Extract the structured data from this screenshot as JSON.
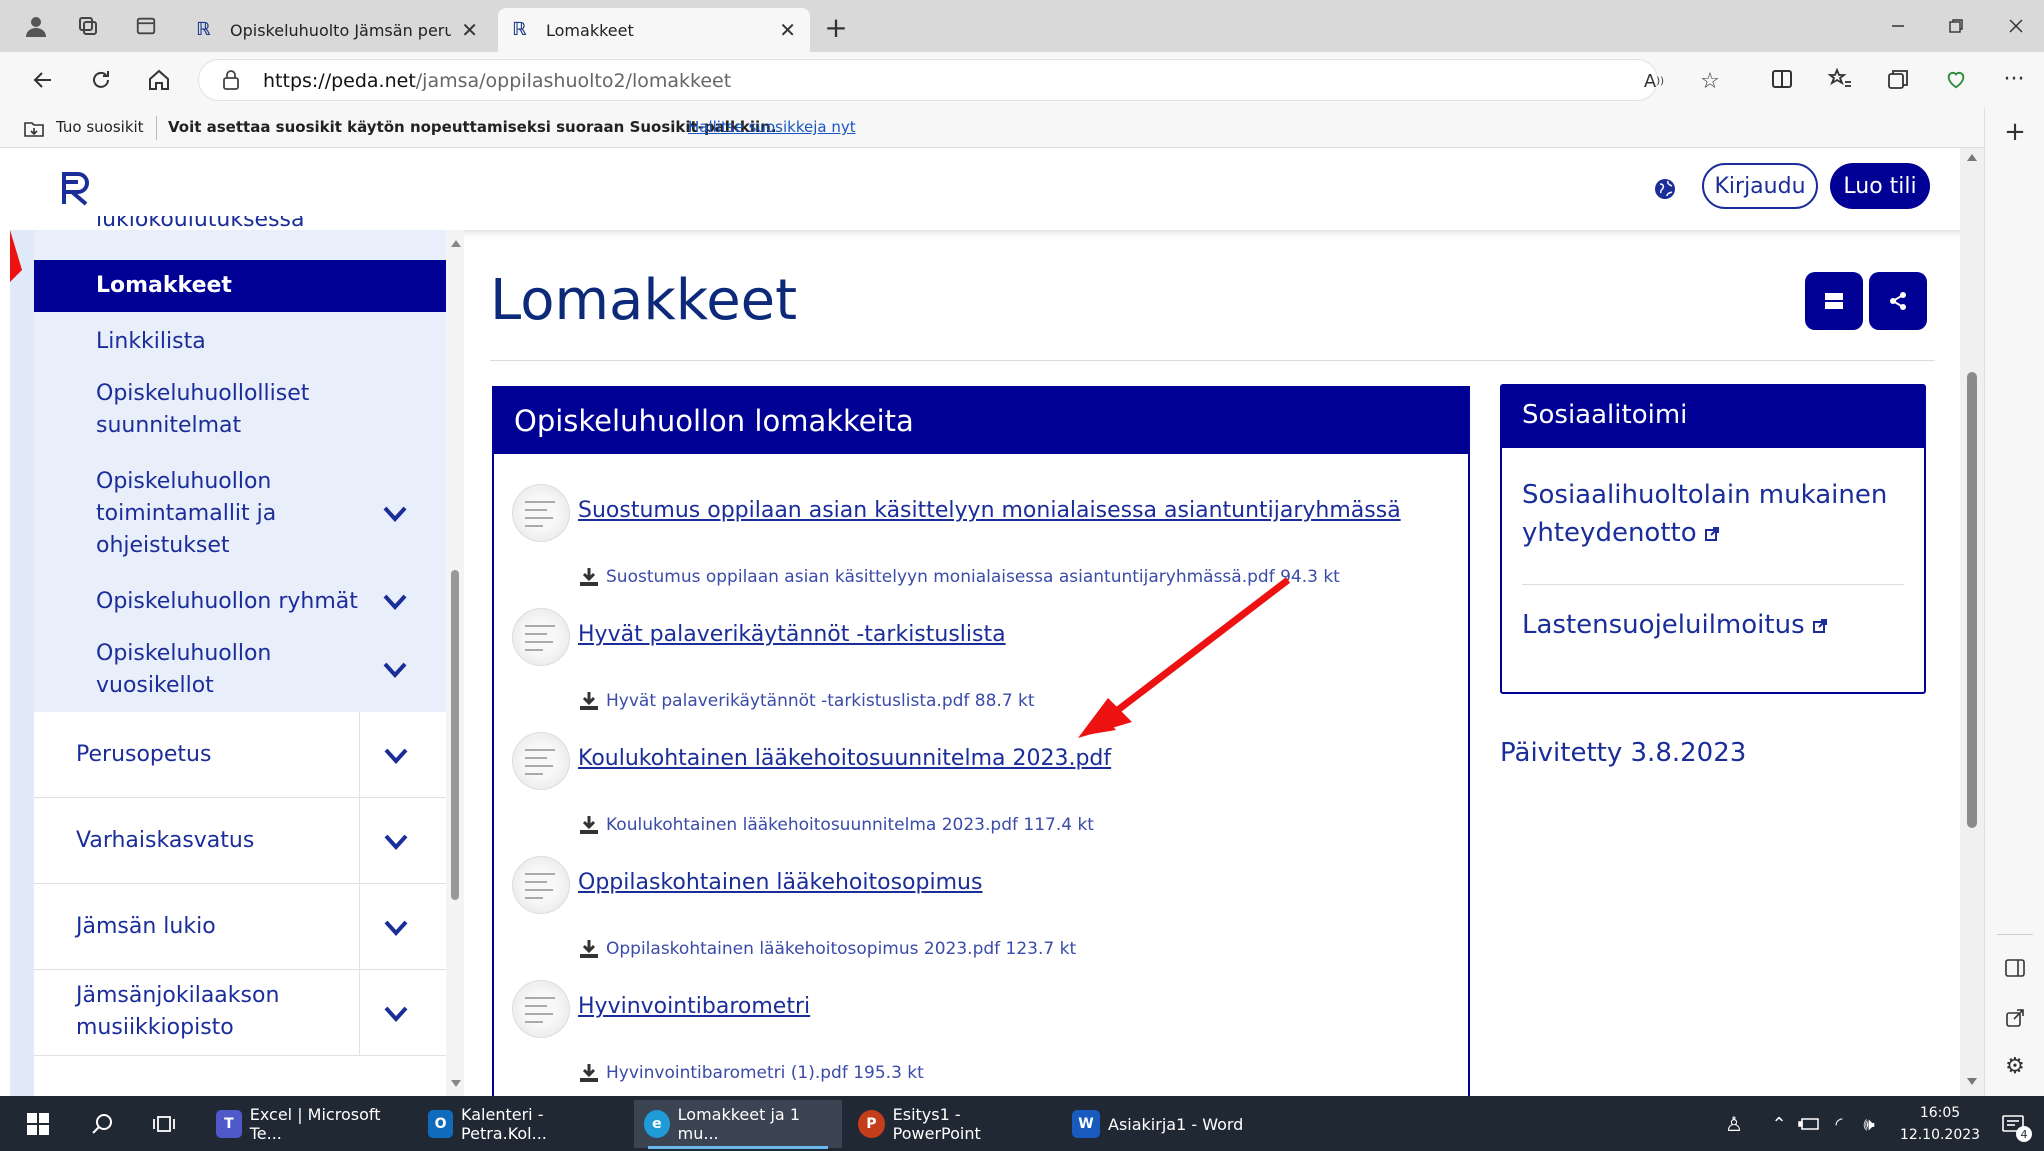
{
  "browser": {
    "tabs": [
      {
        "label": "Opiskeluhuolto Jämsän perusope",
        "active": false
      },
      {
        "label": "Lomakkeet",
        "active": true
      }
    ],
    "url_host": "https://peda.net",
    "url_path": "/jamsa/oppilashuolto2/lomakkeet",
    "favorites_import": "Tuo suosikit",
    "favorites_message": "Voit asettaa suosikit käytön nopeuttamiseksi suoraan Suosikit-palkkiin.",
    "favorites_link": "Hallitse suosikkeja nyt"
  },
  "header": {
    "login": "Kirjaudu",
    "create_account": "Luo tili"
  },
  "sidebar": {
    "partial_item": "lukiokoulutuksessa",
    "sub_items": [
      {
        "label": "Lomakkeet",
        "active": true
      },
      {
        "label": "Linkkilista"
      },
      {
        "label": "Opiskeluhuollolliset suunnitelmat"
      },
      {
        "label": "Opiskeluhuollon toimintamallit ja ohjeistukset"
      },
      {
        "label": "Opiskeluhuollon ryhmät"
      },
      {
        "label": "Opiskeluhuollon vuosikellot"
      }
    ],
    "main_items": [
      {
        "label": "Perusopetus"
      },
      {
        "label": "Varhaiskasvatus"
      },
      {
        "label": "Jämsän lukio"
      },
      {
        "label": "Jämsänjokilaakson musiikkiopisto"
      }
    ]
  },
  "main": {
    "title": "Lomakkeet",
    "card_title": "Opiskeluhuollon lomakkeita",
    "files": [
      {
        "title": "Suostumus oppilaan asian käsittelyyn monialaisessa asiantuntijaryhmässä",
        "download": "Suostumus oppilaan asian käsittelyyn monialaisessa asiantuntijaryhmässä.pdf 94.3 kt"
      },
      {
        "title": "Hyvät palaverikäytännöt -tarkistuslista",
        "download": "Hyvät palaverikäytännöt -tarkistuslista.pdf 88.7 kt"
      },
      {
        "title": "Koulukohtainen lääkehoitosuunnitelma 2023.pdf",
        "download": "Koulukohtainen lääkehoitosuunnitelma 2023.pdf 117.4 kt"
      },
      {
        "title": "Oppilaskohtainen lääkehoitosopimus",
        "download": "Oppilaskohtainen lääkehoitosopimus 2023.pdf 123.7 kt"
      },
      {
        "title": "Hyvinvointibarometri",
        "download": "Hyvinvointibarometri (1).pdf 195.3 kt"
      }
    ]
  },
  "aside": {
    "title": "Sosiaalitoimi",
    "links": [
      {
        "label": "Sosiaalihuoltolain mukainen yhteydenotto"
      },
      {
        "label": "Lastensuojeluilmoitus"
      }
    ],
    "updated": "Päivitetty 3.8.2023"
  },
  "taskbar": {
    "apps": [
      {
        "label": "Excel | Microsoft Te...",
        "color": "#5059c9"
      },
      {
        "label": "Kalenteri - Petra.Kol...",
        "color": "#0f6cbd"
      },
      {
        "label": "Lomakkeet ja 1 mu...",
        "color": "#1f9bd8"
      },
      {
        "label": "Esitys1 - PowerPoint",
        "color": "#c43e1c"
      },
      {
        "label": "Asiakirja1 - Word",
        "color": "#185abd"
      }
    ],
    "time": "16:05",
    "date": "12.10.2023",
    "notifications": "4"
  },
  "colors": {
    "brand": "#000094",
    "link": "#1a2d99",
    "annotation_arrow": "#ee1111"
  }
}
